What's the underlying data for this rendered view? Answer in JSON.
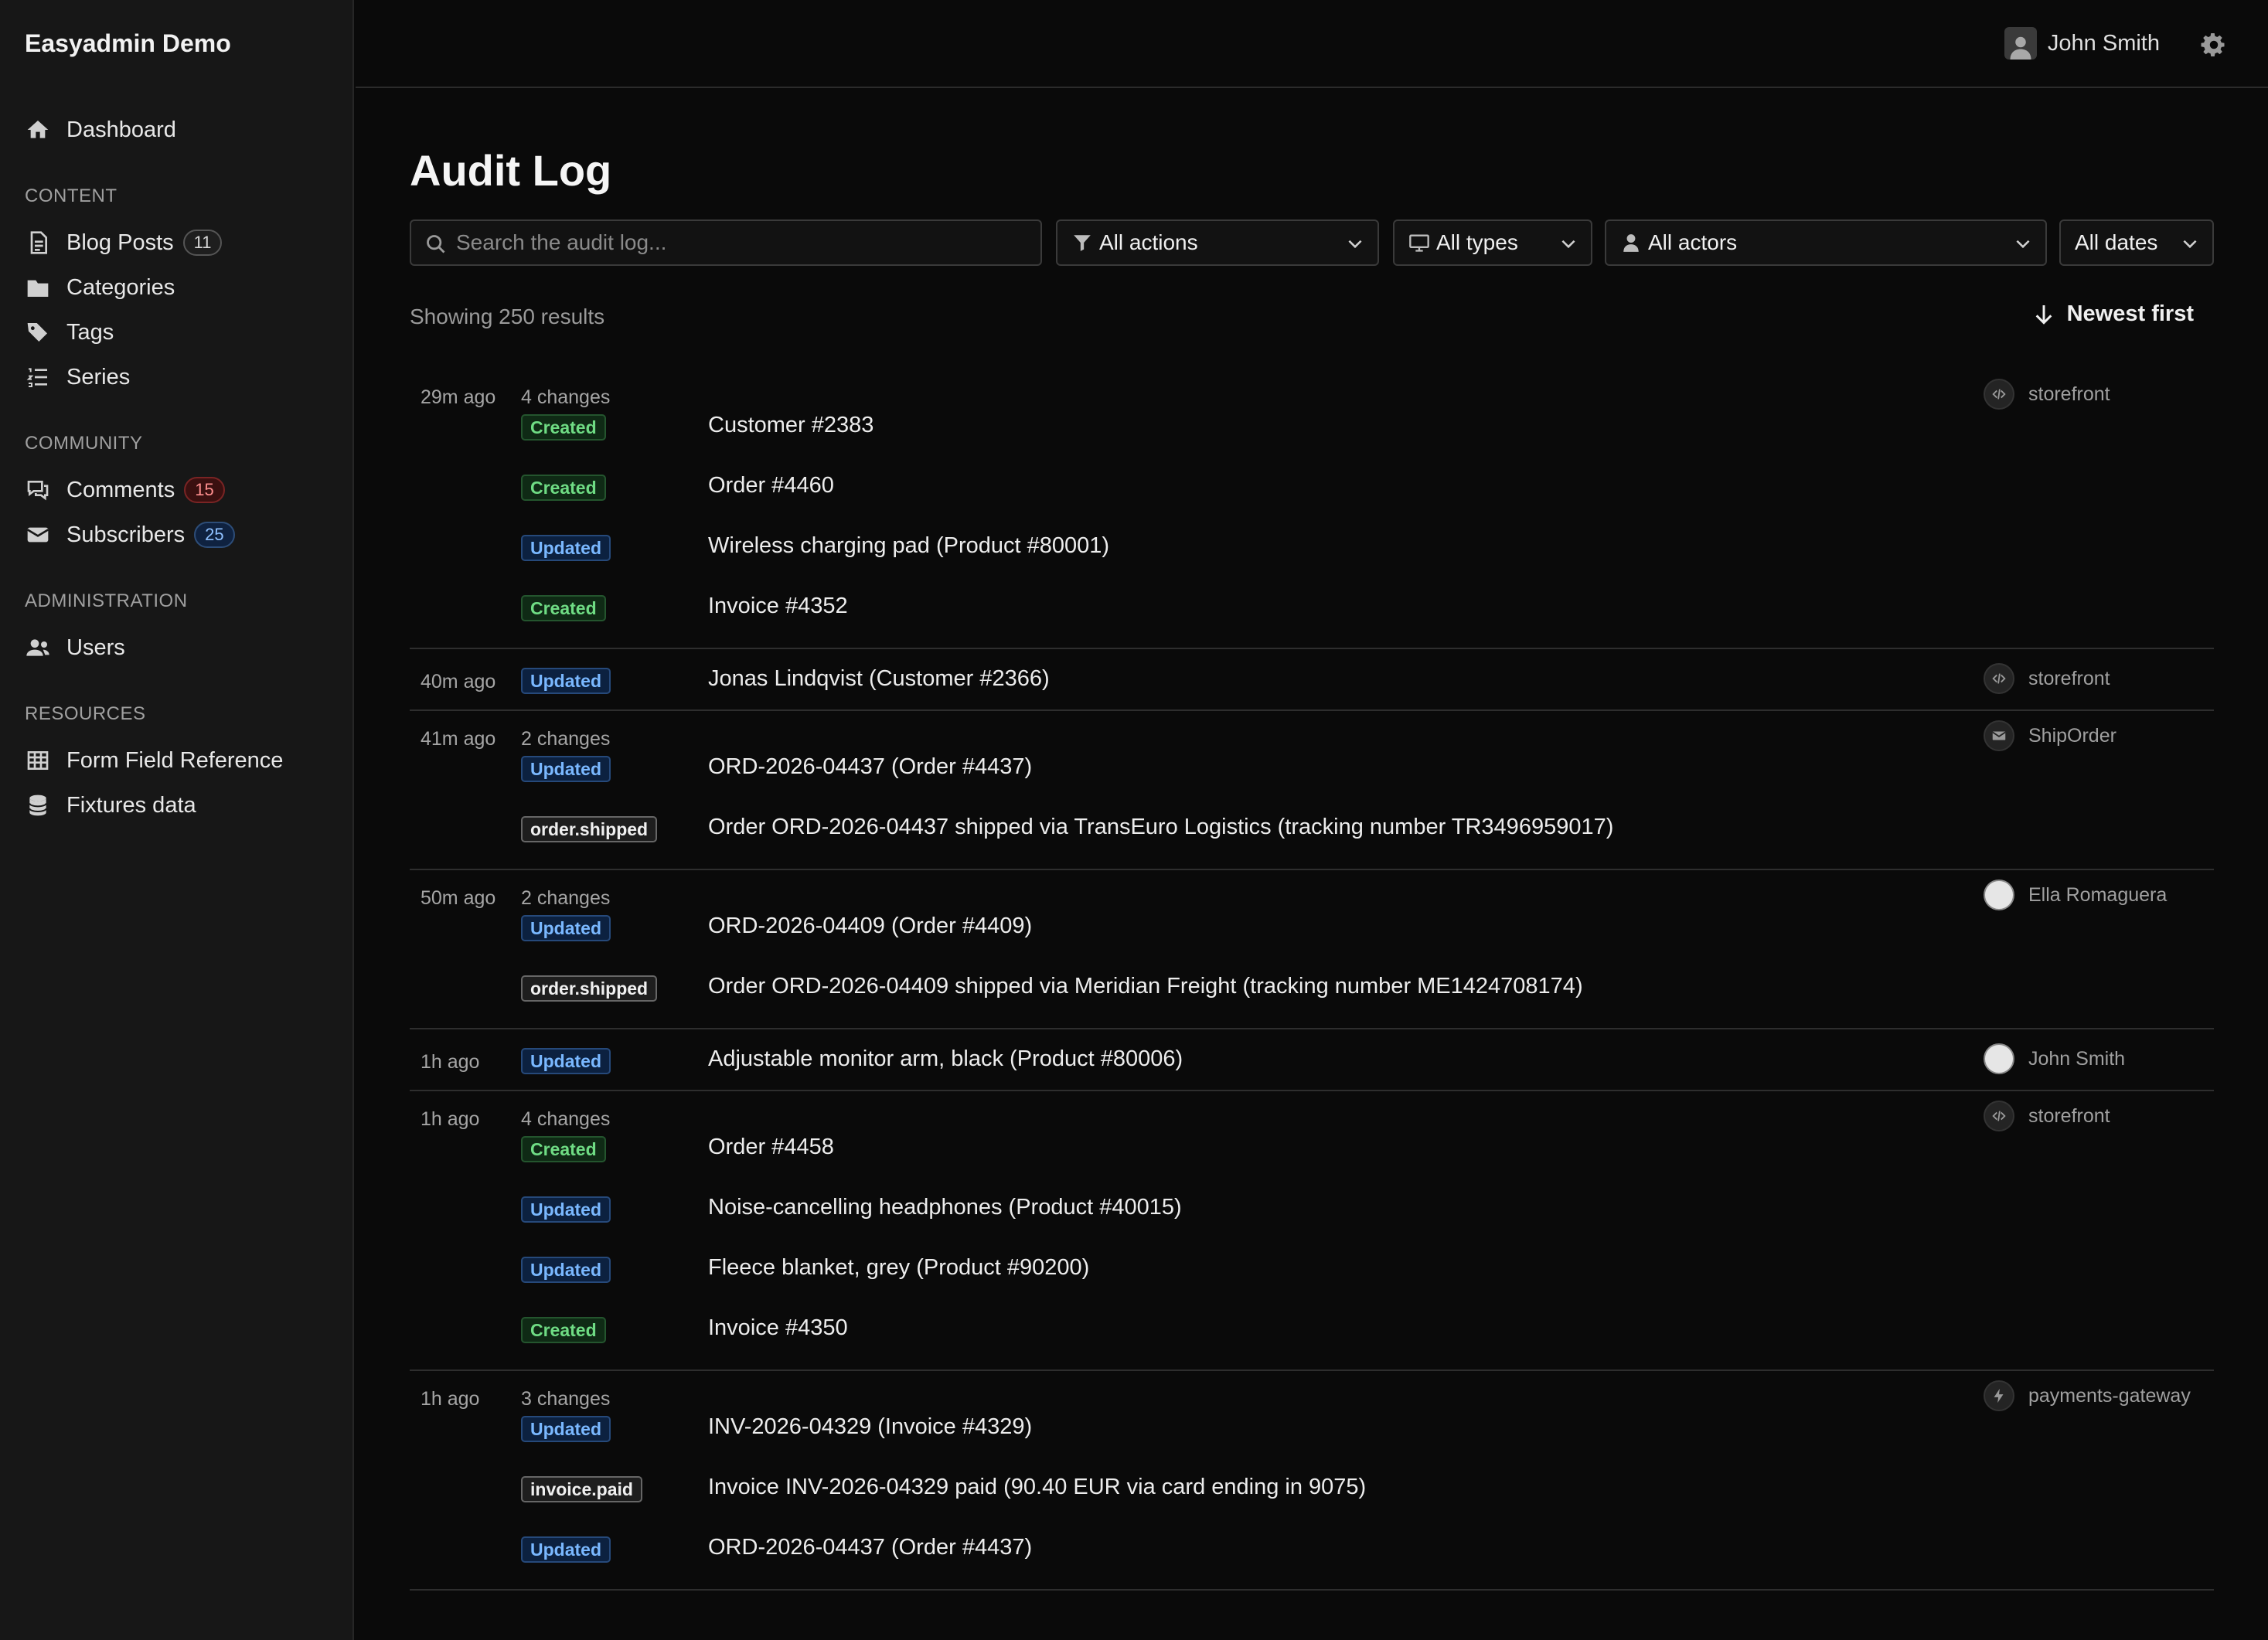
{
  "app": {
    "title": "Easyadmin Demo"
  },
  "sidebar": {
    "dashboard": "Dashboard",
    "content_heading": "CONTENT",
    "blog_posts": "Blog Posts",
    "blog_posts_count": "11",
    "categories": "Categories",
    "tags": "Tags",
    "series": "Series",
    "community_heading": "COMMUNITY",
    "comments": "Comments",
    "comments_count": "15",
    "subscribers": "Subscribers",
    "subscribers_count": "25",
    "administration_heading": "ADMINISTRATION",
    "users": "Users",
    "resources_heading": "RESOURCES",
    "form_field_reference": "Form Field Reference",
    "fixtures_data": "Fixtures data"
  },
  "topbar": {
    "user_name": "John Smith"
  },
  "main": {
    "title": "Audit Log",
    "search_placeholder": "Search the audit log...",
    "filter_actions": "All actions",
    "filter_types": "All types",
    "filter_actors": "All actors",
    "filter_dates": "All dates",
    "results_count": "Showing 250 results",
    "sort_label": "Newest first"
  },
  "entries": [
    {
      "time": "29m ago",
      "changes": "4 changes",
      "actor": "storefront",
      "actor_icon": "code-icon",
      "rows": [
        {
          "tag": "Created",
          "text": "Customer #2383"
        },
        {
          "tag": "Created",
          "text": "Order #4460"
        },
        {
          "tag": "Updated",
          "text": "Wireless charging pad (Product #80001)"
        },
        {
          "tag": "Created",
          "text": "Invoice #4352"
        }
      ]
    },
    {
      "time": "40m ago",
      "changes": "",
      "actor": "storefront",
      "actor_icon": "code-icon",
      "rows": [
        {
          "tag": "Updated",
          "text": "Jonas Lindqvist (Customer #2366)"
        }
      ]
    },
    {
      "time": "41m ago",
      "changes": "2 changes",
      "actor": "ShipOrder",
      "actor_icon": "envelope-icon",
      "rows": [
        {
          "tag": "Updated",
          "text": "ORD-2026-04437 (Order #4437)"
        },
        {
          "tag": "order.shipped",
          "text": "Order ORD-2026-04437 shipped via TransEuro Logistics (tracking number TR3496959017)"
        }
      ]
    },
    {
      "time": "50m ago",
      "changes": "2 changes",
      "actor": "Ella Romaguera",
      "actor_icon": "avatar-icon",
      "rows": [
        {
          "tag": "Updated",
          "text": "ORD-2026-04409 (Order #4409)"
        },
        {
          "tag": "order.shipped",
          "text": "Order ORD-2026-04409 shipped via Meridian Freight (tracking number ME1424708174)"
        }
      ]
    },
    {
      "time": "1h ago",
      "changes": "",
      "actor": "John Smith",
      "actor_icon": "avatar-icon",
      "rows": [
        {
          "tag": "Updated",
          "text": "Adjustable monitor arm, black (Product #80006)"
        }
      ]
    },
    {
      "time": "1h ago",
      "changes": "4 changes",
      "actor": "storefront",
      "actor_icon": "code-icon",
      "rows": [
        {
          "tag": "Created",
          "text": "Order #4458"
        },
        {
          "tag": "Updated",
          "text": "Noise-cancelling headphones (Product #40015)"
        },
        {
          "tag": "Updated",
          "text": "Fleece blanket, grey (Product #90200)"
        },
        {
          "tag": "Created",
          "text": "Invoice #4350"
        }
      ]
    },
    {
      "time": "1h ago",
      "changes": "3 changes",
      "actor": "payments-gateway",
      "actor_icon": "bolt-icon",
      "rows": [
        {
          "tag": "Updated",
          "text": "INV-2026-04329 (Invoice #4329)"
        },
        {
          "tag": "invoice.paid",
          "text": "Invoice INV-2026-04329 paid (90.40 EUR via card ending in 9075)"
        },
        {
          "tag": "Updated",
          "text": "ORD-2026-04437 (Order #4437)"
        }
      ]
    }
  ],
  "colors": {
    "background": "#0a0a0a",
    "sidebar": "#171717",
    "created_tag": "#6fdc84",
    "updated_tag": "#7ab8ff"
  }
}
